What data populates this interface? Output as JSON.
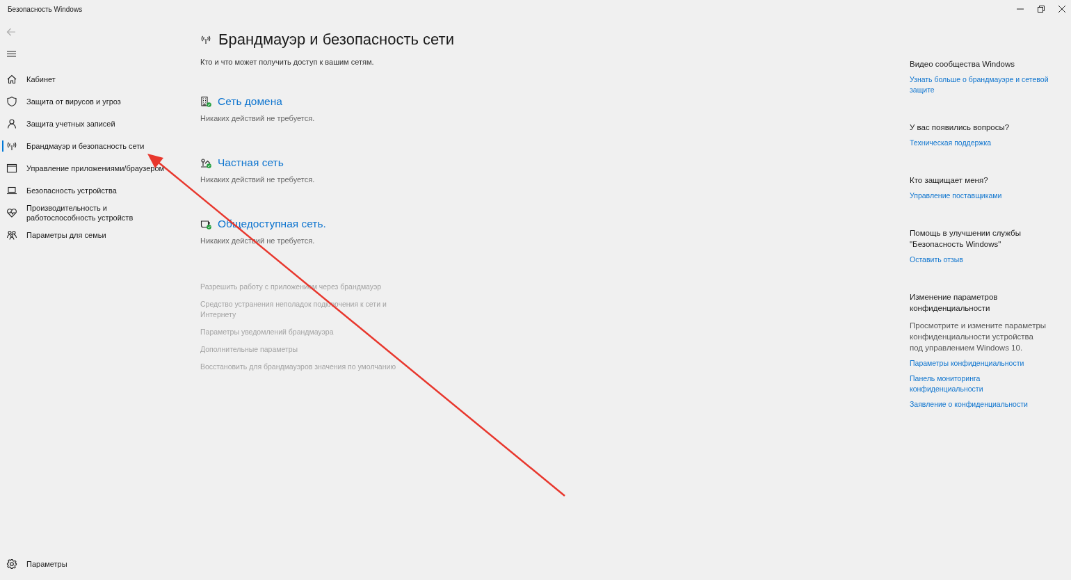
{
  "window": {
    "title": "Безопасность Windows"
  },
  "nav": {
    "items": [
      {
        "label": "Кабинет",
        "kind": "home",
        "selected": false
      },
      {
        "label": "Защита от вирусов и угроз",
        "kind": "shield",
        "selected": false
      },
      {
        "label": "Защита учетных записей",
        "kind": "person",
        "selected": false
      },
      {
        "label": "Брандмауэр и безопасность сети",
        "kind": "antenna",
        "selected": true
      },
      {
        "label": "Управление приложениями/браузером",
        "kind": "window",
        "selected": false
      },
      {
        "label": "Безопасность устройства",
        "kind": "laptop",
        "selected": false
      },
      {
        "label": "Производительность и работоспособность устройств",
        "kind": "heart",
        "selected": false
      },
      {
        "label": "Параметры для семьи",
        "kind": "family",
        "selected": false
      }
    ],
    "footer": {
      "label": "Параметры",
      "kind": "gear"
    }
  },
  "page": {
    "title": "Брандмауэр и безопасность сети",
    "subtitle": "Кто и что может получить доступ к вашим сетям.",
    "networks": [
      {
        "name": "Сеть домена",
        "status": "Никаких действий не требуется.",
        "kind": "domain"
      },
      {
        "name": "Частная сеть",
        "status": "Никаких действий не требуется.",
        "kind": "private"
      },
      {
        "name": "Общедоступная сеть.",
        "status": "Никаких действий не требуется.",
        "kind": "public"
      }
    ],
    "links": [
      "Разрешить работу с приложением через брандмауэр",
      "Средство устранения неполадок подключения к сети и Интернету",
      "Параметры уведомлений брандмауэра",
      "Дополнительные параметры",
      "Восстановить для брандмауэров значения по умолчанию"
    ]
  },
  "aside": {
    "sections": [
      {
        "heading": "Видео сообщества Windows",
        "links": [
          "Узнать больше о брандмауэре и сетевой защите"
        ]
      },
      {
        "heading": "У вас появились вопросы?",
        "links": [
          "Техническая поддержка"
        ]
      },
      {
        "heading": "Кто защищает меня?",
        "links": [
          "Управление поставщиками"
        ]
      },
      {
        "heading": "Помощь в улучшении службы \"Безопасность Windows\"",
        "links": [
          "Оставить отзыв"
        ]
      },
      {
        "heading": "Изменение параметров конфиденциальности",
        "text": "Просмотрите и измените параметры конфиденциальности устройства под управлением Windows 10.",
        "links": [
          "Параметры конфиденциальности",
          "Панель мониторинга конфиденциальности",
          "Заявление о конфиденциальности"
        ]
      }
    ]
  }
}
